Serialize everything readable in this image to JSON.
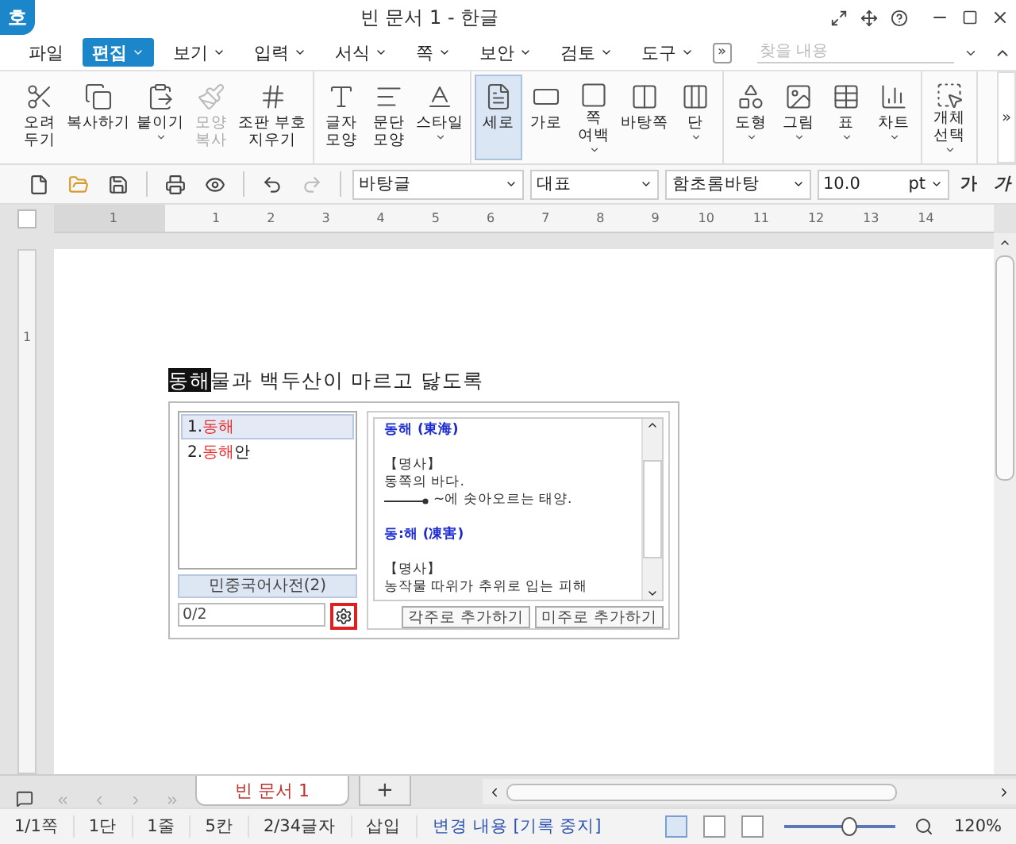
{
  "window": {
    "logo": "호",
    "title": "빈 문서 1 - 한글"
  },
  "menu": {
    "items": [
      {
        "label": "파일",
        "selected": false,
        "dropdown": false
      },
      {
        "label": "편집",
        "selected": true,
        "dropdown": true
      },
      {
        "label": "보기",
        "selected": false,
        "dropdown": true
      },
      {
        "label": "입력",
        "selected": false,
        "dropdown": true
      },
      {
        "label": "서식",
        "selected": false,
        "dropdown": true
      },
      {
        "label": "쪽",
        "selected": false,
        "dropdown": true
      },
      {
        "label": "보안",
        "selected": false,
        "dropdown": true
      },
      {
        "label": "검토",
        "selected": false,
        "dropdown": true
      },
      {
        "label": "도구",
        "selected": false,
        "dropdown": true
      }
    ],
    "more": "»",
    "search": {
      "placeholder": "찾을 내용"
    }
  },
  "ribbon": {
    "groups": [
      {
        "items": [
          {
            "label": "오려\n두기",
            "selected": false,
            "disabled": false,
            "dropdown": false
          },
          {
            "label": "복사하기",
            "selected": false,
            "disabled": false,
            "dropdown": false
          },
          {
            "label": "붙이기",
            "selected": false,
            "disabled": false,
            "dropdown": true
          },
          {
            "label": "모양\n복사",
            "selected": false,
            "disabled": true,
            "dropdown": false
          },
          {
            "label": "조판 부호\n지우기",
            "selected": false,
            "disabled": false,
            "dropdown": false
          }
        ]
      },
      {
        "items": [
          {
            "label": "글자\n모양",
            "selected": false,
            "disabled": false,
            "dropdown": false
          },
          {
            "label": "문단\n모양",
            "selected": false,
            "disabled": false,
            "dropdown": false
          },
          {
            "label": "스타일",
            "selected": false,
            "disabled": false,
            "dropdown": true
          }
        ]
      },
      {
        "items": [
          {
            "label": "세로",
            "selected": true,
            "disabled": false,
            "dropdown": false
          },
          {
            "label": "가로",
            "selected": false,
            "disabled": false,
            "dropdown": false
          },
          {
            "label": "쪽\n여백",
            "selected": false,
            "disabled": false,
            "dropdown": true
          },
          {
            "label": "바탕쪽",
            "selected": false,
            "disabled": false,
            "dropdown": false
          },
          {
            "label": "단",
            "selected": false,
            "disabled": false,
            "dropdown": true
          }
        ]
      },
      {
        "items": [
          {
            "label": "도형",
            "selected": false,
            "disabled": false,
            "dropdown": true
          },
          {
            "label": "그림",
            "selected": false,
            "disabled": false,
            "dropdown": true
          },
          {
            "label": "표",
            "selected": false,
            "disabled": false,
            "dropdown": true
          },
          {
            "label": "차트",
            "selected": false,
            "disabled": false,
            "dropdown": true
          }
        ]
      },
      {
        "items": [
          {
            "label": "개체\n선택",
            "selected": false,
            "disabled": false,
            "dropdown": true
          }
        ]
      }
    ],
    "more": "»"
  },
  "format_bar": {
    "style": "바탕글",
    "language": "대표",
    "font": "함초롬바탕",
    "size": "10.0",
    "unit": "pt",
    "bold": "가",
    "italic": "가"
  },
  "ruler": {
    "left_label": "1",
    "labels": [
      "1",
      "2",
      "3",
      "4",
      "5",
      "6",
      "7",
      "8",
      "9",
      "10",
      "11",
      "12",
      "13",
      "14"
    ],
    "vertical_label": "1"
  },
  "document": {
    "highlight": "동해",
    "text": "물과 백두산이 마르고 닳도록"
  },
  "dictionary_popup": {
    "candidates": [
      {
        "number": "1.",
        "match": "동해",
        "selected": true
      },
      {
        "number": "2.",
        "match": "동해",
        "rest": "안",
        "selected": false
      }
    ],
    "dictionary_name": "민중국어사전(2)",
    "counter": "0/2",
    "entries": [
      {
        "kind": "heading",
        "text": "동해 (東海)"
      },
      {
        "kind": "blank"
      },
      {
        "kind": "pos",
        "text": "【명사】"
      },
      {
        "kind": "definition",
        "text": "동쪽의 바다."
      },
      {
        "kind": "example",
        "text": "~에 솟아오르는 태양."
      },
      {
        "kind": "blank"
      },
      {
        "kind": "heading",
        "text": "동:해 (凍害)"
      },
      {
        "kind": "blank"
      },
      {
        "kind": "pos",
        "text": "【명사】"
      },
      {
        "kind": "definition",
        "text": "농작물 따위가 추위로 입는 피해"
      }
    ],
    "buttons": [
      "각주로 추가하기",
      "미주로 추가하기"
    ]
  },
  "doc_tabs": {
    "tabs": [
      {
        "label": "빈 문서 1",
        "selected": true
      }
    ],
    "add": "+"
  },
  "status_bar": {
    "items": [
      "1/1쪽",
      "1단",
      "1줄",
      "5칸",
      "2/34글자",
      "삽입"
    ],
    "track_changes": "변경 내용 [기록 중지]",
    "zoom": {
      "level": 0.58,
      "reading": "120%"
    }
  }
}
